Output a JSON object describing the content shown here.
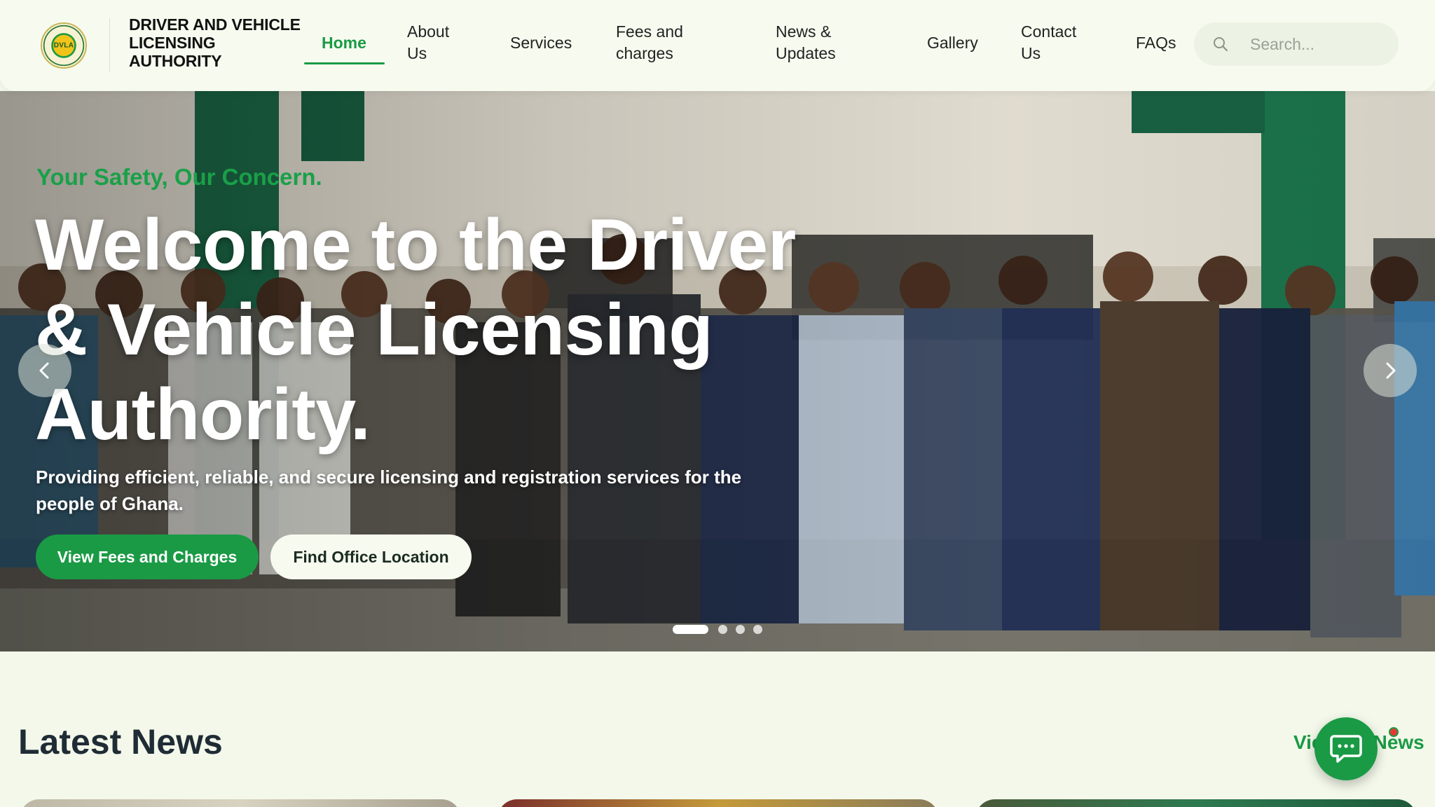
{
  "header": {
    "logo_text": "DVLA",
    "brand_lines": [
      "DRIVER AND VEHICLE",
      "LICENSING",
      "AUTHORITY"
    ],
    "nav": [
      {
        "label": "Home",
        "active": true
      },
      {
        "label": "About Us"
      },
      {
        "label": "Services"
      },
      {
        "label": "Fees and charges"
      },
      {
        "label": "News & Updates"
      },
      {
        "label": "Gallery"
      },
      {
        "label": "Contact Us"
      },
      {
        "label": "FAQs"
      }
    ],
    "search": {
      "placeholder": "Search..."
    }
  },
  "hero": {
    "tagline": "Your Safety, Our Concern.",
    "title": "Welcome to the Driver & Vehicle Licensing Authority.",
    "subtitle": "Providing efficient, reliable, and secure licensing and registration services for the people of Ghana.",
    "primary_button": "View Fees and Charges",
    "secondary_button": "Find Office Location",
    "slides_total": 4,
    "active_slide": 1
  },
  "news": {
    "title": "Latest News",
    "view_all": "View All News"
  },
  "colors": {
    "accent": "#1a9a45",
    "background": "#f3f8ea",
    "header_bg": "#f7fbef"
  },
  "icons": {
    "search": "search-icon",
    "prev": "chevron-left-icon",
    "next": "chevron-right-icon",
    "chat": "chat-icon"
  }
}
